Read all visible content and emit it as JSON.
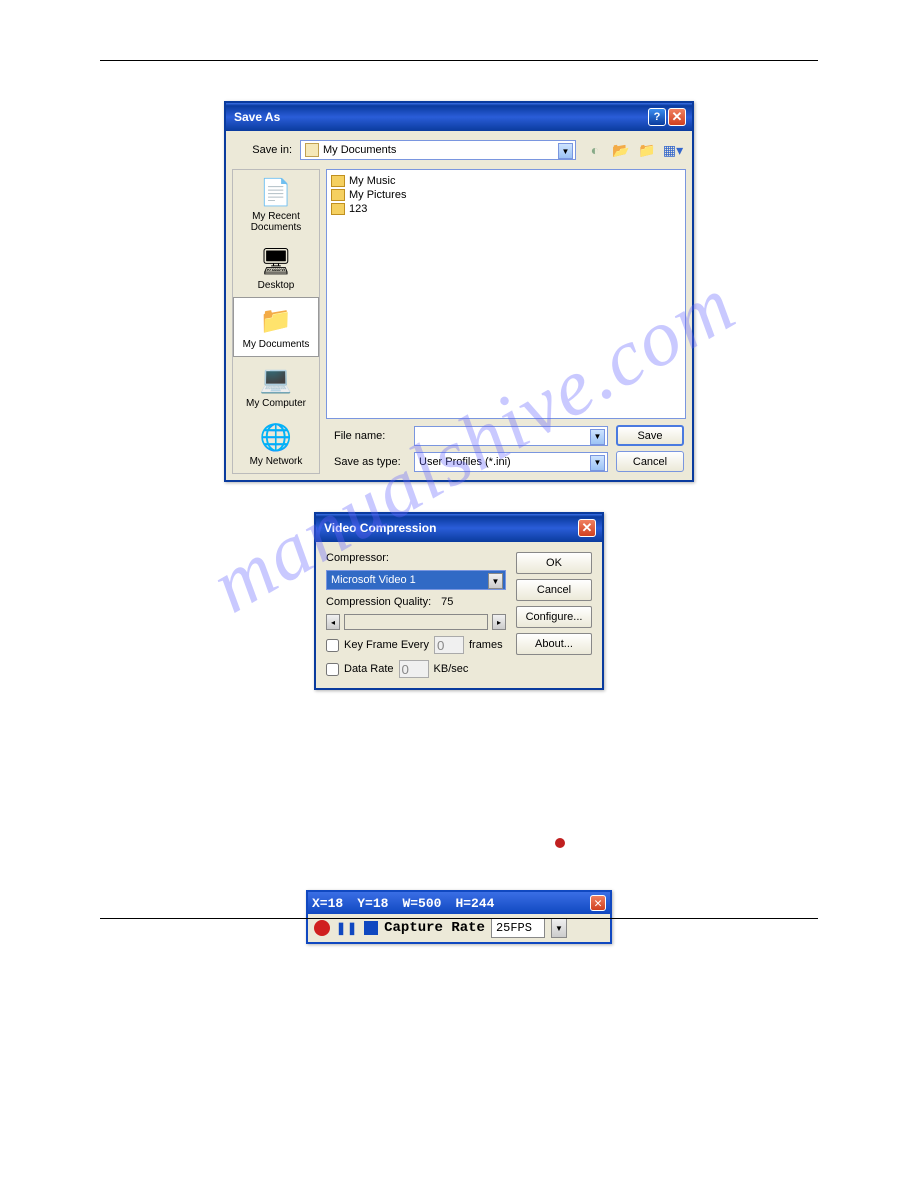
{
  "saveas": {
    "title": "Save As",
    "savein_label": "Save in:",
    "savein_value": "My Documents",
    "places": [
      {
        "label": "My Recent Documents",
        "icon": "📄"
      },
      {
        "label": "Desktop",
        "icon": "🖥"
      },
      {
        "label": "My Documents",
        "icon": "📁",
        "selected": true
      },
      {
        "label": "My Computer",
        "icon": "💻"
      },
      {
        "label": "My Network",
        "icon": "🌐"
      }
    ],
    "files": [
      {
        "name": "My Music"
      },
      {
        "name": "My Pictures"
      },
      {
        "name": "123"
      }
    ],
    "filename_label": "File name:",
    "filename_value": "",
    "saveastype_label": "Save as type:",
    "saveastype_value": "User Profiles (*.ini)",
    "save_btn": "Save",
    "cancel_btn": "Cancel"
  },
  "vc": {
    "title": "Video Compression",
    "compressor_label": "Compressor:",
    "compressor_value": "Microsoft Video 1",
    "quality_label": "Compression Quality:",
    "quality_value": "75",
    "keyframe_label": "Key Frame Every",
    "keyframe_value": "0",
    "keyframe_unit": "frames",
    "datarate_label": "Data Rate",
    "datarate_value": "0",
    "datarate_unit": "KB/sec",
    "ok_btn": "OK",
    "cancel_btn": "Cancel",
    "configure_btn": "Configure...",
    "about_btn": "About..."
  },
  "capture": {
    "x": "X=18",
    "y": "Y=18",
    "w": "W=500",
    "h": "H=244",
    "rate_label": "Capture Rate",
    "rate_value": "25FPS"
  }
}
